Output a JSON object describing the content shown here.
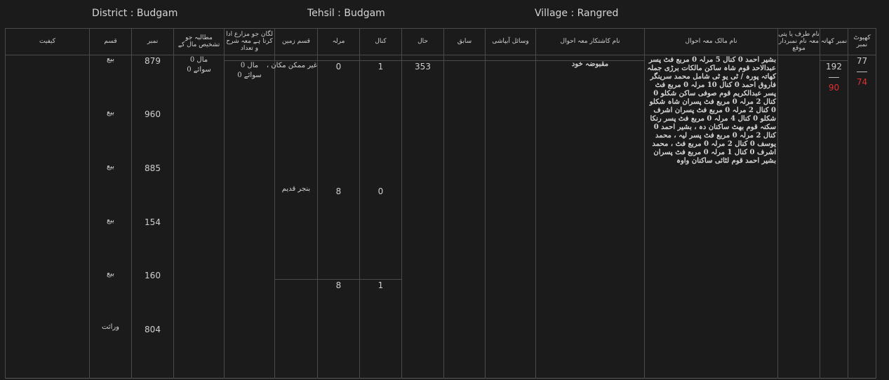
{
  "header": {
    "district": "District : Budgam",
    "tehsil": "Tehsil : Budgam",
    "village": "Village : Rangred"
  },
  "columns": {
    "khewat_no": "کھیوٹ نمبر",
    "khata_no": "نمبر کھاتہ",
    "caste": "نام طرف یا پتی معہ نام نمبردار موقع",
    "owner": "نام مالک معہ احوال",
    "cultivator": "نام کاشتکار معہ احوال",
    "irrigation": "وسائل آبپاشی",
    "sabiq": "سابق",
    "hal": "حال",
    "kanal": "کنال",
    "marla": "مرلہ",
    "land_type": "قسم زمین",
    "rent_cols": "لگان جو مزارع ادا کرتا ہے معہ شرح و تعداد",
    "revenue": "مطالبہ جو تشخیص مال کے",
    "number": "نمبر",
    "qism": "قسم",
    "kaifiyat": "کیفیت"
  },
  "row": {
    "khewat_top": "77",
    "khewat_bottom": "74",
    "khata_top": "192",
    "khata_bottom": "90",
    "owner_text": "بشیر احمد 0 کنال 5 مرلہ 0 مربع فٹ پسر عبدالاحد قوم شاہ ساکن مالکات برڑی جملہ کھاتہ پورہ / ٹی یو ٹی شامل محمد سرینگر فاروق احمد 0 کنال 10 مرلہ 0 مربع فٹ پسر عبدالکریم قوم صوفی ساکن شکلو 0 کنال 2 مرلہ 0 مربع فٹ پسران شاہ شکلو 0 کنال 2 مرلہ 0 مربع فٹ پسران اشرف شکلو 0 کنال 4 مرلہ 0 مربع فٹ پسر رنکا سکنہ قوم بھٹ ساکنان دہ ، بشیر احمد 0 کنال 2 مرلہ 0 مربع فٹ پسر لیہ ، محمد یوسف 0 کنال 2 مرلہ 0 مربع فٹ ، محمد اشرف 0 کنال 1 مرلہ 0 مربع فٹ پسران بشیر احمد قوم لٹائی ساکنان واوہ",
    "cultivator_text": "مقبوضہ خود",
    "hal": "353",
    "kanal_1": "1",
    "marla_1": "0",
    "kanal_2": "0",
    "marla_2": "8",
    "kanal_total": "1",
    "marla_total": "8",
    "land_type_1": "غیر ممکن مکان ،",
    "land_type_2": "بنجر قدیم",
    "rent_line1": "مال 0",
    "rent_line2": "سوائے 0",
    "revenue_line1": "مال 0",
    "revenue_line2": "سوائے 0",
    "entries": [
      {
        "number": "879",
        "qism": "بیع"
      },
      {
        "number": "960",
        "qism": "بیع"
      },
      {
        "number": "885",
        "qism": "بیع"
      },
      {
        "number": "154",
        "qism": "بیع"
      },
      {
        "number": "160",
        "qism": "بیع"
      },
      {
        "number": "804",
        "qism": "وراثت"
      }
    ]
  },
  "colors": {
    "background": "#1b1b1b",
    "grid": "#4a4a4a",
    "text": "#d8d8d8",
    "accent_red": "#e03030"
  }
}
